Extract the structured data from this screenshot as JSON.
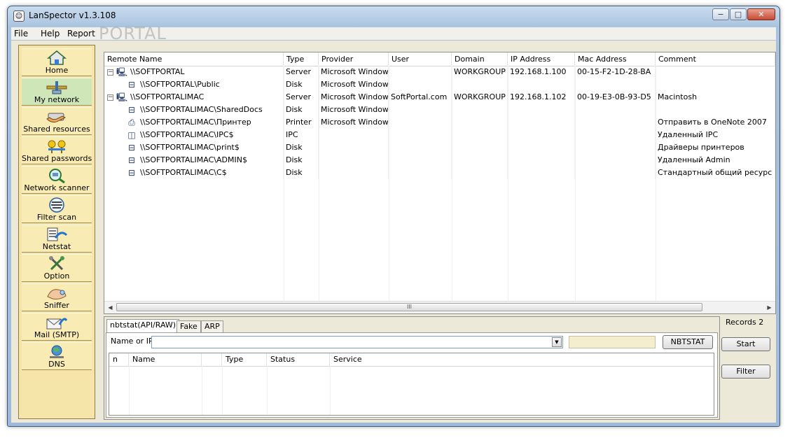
{
  "window": {
    "title": "LanSpector v1.3.108",
    "app_icon_glyph": "☺",
    "controls": {
      "minimize": "−",
      "maximize": "□",
      "close": "✕"
    }
  },
  "watermark": "PORTAL",
  "menu": [
    "File",
    "Help",
    "Report"
  ],
  "sidebar": {
    "items": [
      {
        "label": "Home",
        "icon": "home-icon",
        "active": false
      },
      {
        "label": "My network",
        "icon": "network-icon",
        "active": true
      },
      {
        "label": "Shared resources",
        "icon": "shared-resources-icon",
        "active": false
      },
      {
        "label": "Shared passwords",
        "icon": "shared-passwords-icon",
        "active": false
      },
      {
        "label": "Network scanner",
        "icon": "network-scanner-icon",
        "active": false
      },
      {
        "label": "Filter scan",
        "icon": "filter-scan-icon",
        "active": false
      },
      {
        "label": "Netstat",
        "icon": "netstat-icon",
        "active": false
      },
      {
        "label": "Option",
        "icon": "option-icon",
        "active": false
      },
      {
        "label": "Sniffer",
        "icon": "sniffer-icon",
        "active": false
      },
      {
        "label": "Mail (SMTP)",
        "icon": "mail-icon",
        "active": false
      },
      {
        "label": "DNS",
        "icon": "dns-icon",
        "active": false
      }
    ]
  },
  "resources": {
    "columns": [
      "Remote Name",
      "Type",
      "Provider",
      "User",
      "Domain",
      "IP Address",
      "Mac Address",
      "Comment"
    ],
    "rows": [
      {
        "level": 0,
        "expand": "−",
        "icon": "computer-icon",
        "name": "\\\\SOFTPORTAL",
        "type": "Server",
        "provider": "Microsoft Window...",
        "user": "",
        "domain": "WORKGROUP",
        "ip": "192.168.1.100",
        "mac": "00-15-F2-1D-28-BA",
        "comment": ""
      },
      {
        "level": 1,
        "expand": "",
        "icon": "disk-share-icon",
        "name": "\\\\SOFTPORTAL\\Public",
        "type": "Disk",
        "provider": "Microsoft Window...",
        "user": "",
        "domain": "",
        "ip": "",
        "mac": "",
        "comment": ""
      },
      {
        "level": 0,
        "expand": "−",
        "icon": "computer-user-icon",
        "name": "\\\\SOFTPORTALIMAC",
        "type": "Server",
        "provider": "Microsoft Window...",
        "user": "SoftPortal.com",
        "domain": "WORKGROUP",
        "ip": "192.168.1.102",
        "mac": "00-19-E3-0B-93-D5",
        "comment": "Macintosh"
      },
      {
        "level": 1,
        "expand": "",
        "icon": "disk-share-icon",
        "name": "\\\\SOFTPORTALIMAC\\SharedDocs",
        "type": "Disk",
        "provider": "Microsoft Window...",
        "user": "",
        "domain": "",
        "ip": "",
        "mac": "",
        "comment": ""
      },
      {
        "level": 1,
        "expand": "",
        "icon": "printer-icon",
        "name": "\\\\SOFTPORTALIMAC\\Принтер",
        "type": "Printer",
        "provider": "Microsoft Window...",
        "user": "",
        "domain": "",
        "ip": "",
        "mac": "",
        "comment": "Отправить в OneNote 2007"
      },
      {
        "level": 1,
        "expand": "",
        "icon": "ipc-icon",
        "name": "\\\\SOFTPORTALIMAC\\IPC$",
        "type": "IPC",
        "provider": "",
        "user": "",
        "domain": "",
        "ip": "",
        "mac": "",
        "comment": "Удаленный IPC"
      },
      {
        "level": 1,
        "expand": "",
        "icon": "disk-share-icon",
        "name": "\\\\SOFTPORTALIMAC\\print$",
        "type": "Disk",
        "provider": "",
        "user": "",
        "domain": "",
        "ip": "",
        "mac": "",
        "comment": "Драйверы принтеров"
      },
      {
        "level": 1,
        "expand": "",
        "icon": "disk-share-icon",
        "name": "\\\\SOFTPORTALIMAC\\ADMIN$",
        "type": "Disk",
        "provider": "",
        "user": "",
        "domain": "",
        "ip": "",
        "mac": "",
        "comment": "Удаленный Admin"
      },
      {
        "level": 1,
        "expand": "",
        "icon": "disk-share-icon",
        "name": "\\\\SOFTPORTALIMAC\\C$",
        "type": "Disk",
        "provider": "",
        "user": "",
        "domain": "",
        "ip": "",
        "mac": "",
        "comment": "Стандартный общий ресурс"
      }
    ],
    "scroll_left": "◀",
    "scroll_right": "▶",
    "scroll_grip": "III"
  },
  "bottom": {
    "tabs": [
      "nbtstat(API/RAW)",
      "Fake",
      "ARP"
    ],
    "active_tab": 0,
    "name_label": "Name or IP",
    "name_value": "",
    "combo_arrow": "▼",
    "nbtstat_button": "NBTSTAT",
    "columns": [
      "n",
      "Name",
      "",
      "Type",
      "Status",
      "Service"
    ]
  },
  "records_label": "Records 2",
  "start_button": "Start",
  "filter_button": "Filter"
}
